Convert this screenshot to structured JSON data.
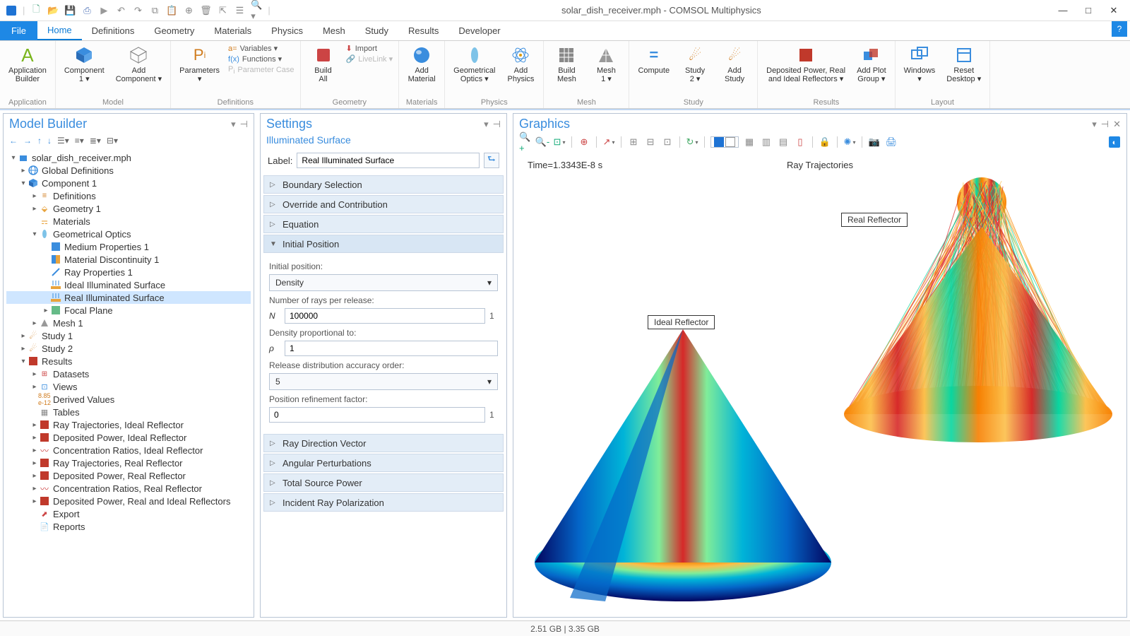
{
  "window": {
    "title": "solar_dish_receiver.mph - COMSOL Multiphysics",
    "minimize": "—",
    "maximize": "□",
    "close": "✕"
  },
  "menu": {
    "file": "File",
    "tabs": [
      "Home",
      "Definitions",
      "Geometry",
      "Materials",
      "Physics",
      "Mesh",
      "Study",
      "Results",
      "Developer"
    ],
    "active_tab": "Home"
  },
  "ribbon": {
    "groups": {
      "application": {
        "label": "Application",
        "items": {
          "app_builder": "Application\nBuilder"
        }
      },
      "model": {
        "label": "Model",
        "items": {
          "component": "Component\n1 ▾",
          "add_component": "Add\nComponent ▾"
        }
      },
      "definitions": {
        "label": "Definitions",
        "items": {
          "parameters": "Parameters\n▾",
          "variables": "Variables ▾",
          "functions": "Functions ▾",
          "param_case": "Parameter Case"
        }
      },
      "geometry": {
        "label": "Geometry",
        "items": {
          "build_all": "Build\nAll",
          "import": "Import",
          "livelink": "LiveLink ▾"
        }
      },
      "materials": {
        "label": "Materials",
        "items": {
          "add_material": "Add\nMaterial"
        }
      },
      "physics": {
        "label": "Physics",
        "items": {
          "geom_optics": "Geometrical\nOptics ▾",
          "add_physics": "Add\nPhysics"
        }
      },
      "mesh": {
        "label": "Mesh",
        "items": {
          "build_mesh": "Build\nMesh",
          "mesh1": "Mesh\n1 ▾"
        }
      },
      "study": {
        "label": "Study",
        "items": {
          "compute": "Compute",
          "study2": "Study\n2 ▾",
          "add_study": "Add\nStudy"
        }
      },
      "results": {
        "label": "Results",
        "items": {
          "deposited": "Deposited Power, Real\nand Ideal Reflectors ▾",
          "add_plot": "Add Plot\nGroup ▾"
        }
      },
      "layout": {
        "label": "Layout",
        "items": {
          "windows": "Windows\n▾",
          "reset": "Reset\nDesktop ▾"
        }
      }
    }
  },
  "model_builder": {
    "title": "Model Builder",
    "tree": [
      {
        "d": 0,
        "exp": "▾",
        "icon": "root",
        "label": "solar_dish_receiver.mph"
      },
      {
        "d": 1,
        "exp": "▸",
        "icon": "globe",
        "label": "Global Definitions"
      },
      {
        "d": 1,
        "exp": "▾",
        "icon": "comp",
        "label": "Component 1"
      },
      {
        "d": 2,
        "exp": "▸",
        "icon": "def",
        "label": "Definitions"
      },
      {
        "d": 2,
        "exp": "▸",
        "icon": "geom",
        "label": "Geometry 1"
      },
      {
        "d": 2,
        "exp": "",
        "icon": "mat",
        "label": "Materials"
      },
      {
        "d": 2,
        "exp": "▾",
        "icon": "optics",
        "label": "Geometrical Optics"
      },
      {
        "d": 3,
        "exp": "",
        "icon": "medium",
        "label": "Medium Properties 1"
      },
      {
        "d": 3,
        "exp": "",
        "icon": "matdisc",
        "label": "Material Discontinuity 1"
      },
      {
        "d": 3,
        "exp": "",
        "icon": "ray",
        "label": "Ray Properties 1"
      },
      {
        "d": 3,
        "exp": "",
        "icon": "illum",
        "label": "Ideal Illuminated Surface"
      },
      {
        "d": 3,
        "exp": "",
        "icon": "illum",
        "label": "Real Illuminated Surface",
        "selected": true
      },
      {
        "d": 3,
        "exp": "▸",
        "icon": "focal",
        "label": "Focal Plane"
      },
      {
        "d": 2,
        "exp": "▸",
        "icon": "mesh",
        "label": "Mesh 1"
      },
      {
        "d": 1,
        "exp": "▸",
        "icon": "study",
        "label": "Study 1"
      },
      {
        "d": 1,
        "exp": "▸",
        "icon": "study",
        "label": "Study 2"
      },
      {
        "d": 1,
        "exp": "▾",
        "icon": "results",
        "label": "Results"
      },
      {
        "d": 2,
        "exp": "▸",
        "icon": "dataset",
        "label": "Datasets"
      },
      {
        "d": 2,
        "exp": "▸",
        "icon": "views",
        "label": "Views"
      },
      {
        "d": 2,
        "exp": "",
        "icon": "derived",
        "label": "Derived Values"
      },
      {
        "d": 2,
        "exp": "",
        "icon": "tables",
        "label": "Tables"
      },
      {
        "d": 2,
        "exp": "▸",
        "icon": "plot3d",
        "label": "Ray Trajectories, Ideal Reflector"
      },
      {
        "d": 2,
        "exp": "▸",
        "icon": "plot3d",
        "label": "Deposited Power, Ideal Reflector"
      },
      {
        "d": 2,
        "exp": "▸",
        "icon": "plot1d",
        "label": "Concentration Ratios, Ideal Reflector"
      },
      {
        "d": 2,
        "exp": "▸",
        "icon": "plot3d",
        "label": "Ray Trajectories, Real Reflector"
      },
      {
        "d": 2,
        "exp": "▸",
        "icon": "plot3d",
        "label": "Deposited Power, Real Reflector"
      },
      {
        "d": 2,
        "exp": "▸",
        "icon": "plot1d",
        "label": "Concentration Ratios, Real Reflector"
      },
      {
        "d": 2,
        "exp": "▸",
        "icon": "plot3d",
        "label": "Deposited Power, Real and Ideal Reflectors"
      },
      {
        "d": 2,
        "exp": "",
        "icon": "export",
        "label": "Export"
      },
      {
        "d": 2,
        "exp": "",
        "icon": "reports",
        "label": "Reports"
      }
    ]
  },
  "settings": {
    "title": "Settings",
    "subtitle": "Illuminated Surface",
    "label_caption": "Label:",
    "label_value": "Real Illuminated Surface",
    "sections": {
      "boundary_selection": "Boundary Selection",
      "override": "Override and Contribution",
      "equation": "Equation",
      "initial_position": "Initial Position",
      "ray_direction": "Ray Direction Vector",
      "angular_perturb": "Angular Perturbations",
      "total_source": "Total Source Power",
      "incident_pol": "Incident Ray Polarization"
    },
    "initial_position": {
      "caption": "Initial position:",
      "dropdown": "Density",
      "num_rays_label": "Number of rays per release:",
      "num_rays_sym": "N",
      "num_rays_value": "100000",
      "num_rays_unit": "1",
      "density_label": "Density proportional to:",
      "density_sym": "ρ",
      "density_value": "1",
      "accuracy_label": "Release distribution accuracy order:",
      "accuracy_value": "5",
      "refinement_label": "Position refinement factor:",
      "refinement_value": "0",
      "refinement_unit": "1"
    }
  },
  "graphics": {
    "title": "Graphics",
    "time_annot": "Time=1.3343E-8 s",
    "plot_title": "Ray Trajectories",
    "label_ideal": "Ideal Reflector",
    "label_real": "Real Reflector"
  },
  "statusbar": {
    "memory": "2.51 GB | 3.35 GB"
  }
}
